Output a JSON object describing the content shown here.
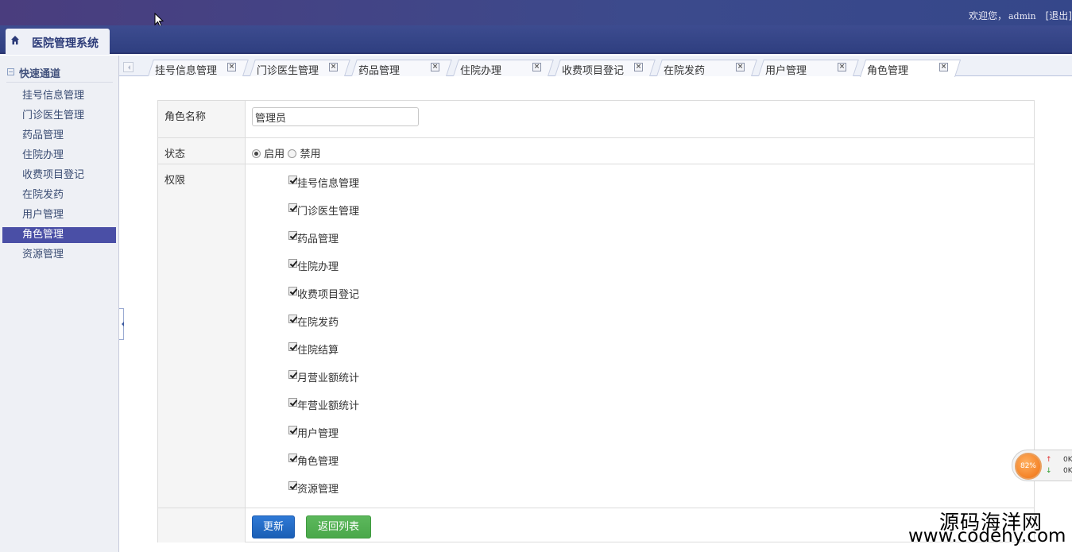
{
  "header": {
    "welcome": "欢迎您，",
    "user": "admin",
    "logout": "[退出]",
    "system_title": "医院管理系统"
  },
  "sidebar": {
    "section_title": "快速通道",
    "items": [
      {
        "label": "挂号信息管理"
      },
      {
        "label": "门诊医生管理"
      },
      {
        "label": "药品管理"
      },
      {
        "label": "住院办理"
      },
      {
        "label": "收费项目登记"
      },
      {
        "label": "在院发药"
      },
      {
        "label": "用户管理"
      },
      {
        "label": "角色管理",
        "active": true
      },
      {
        "label": "资源管理"
      }
    ]
  },
  "tabs": [
    {
      "label": "挂号信息管理"
    },
    {
      "label": "门诊医生管理"
    },
    {
      "label": "药品管理"
    },
    {
      "label": "住院办理"
    },
    {
      "label": "收费项目登记"
    },
    {
      "label": "在院发药"
    },
    {
      "label": "用户管理"
    },
    {
      "label": "角色管理",
      "active": true
    }
  ],
  "tab_close_glyph": "×",
  "form": {
    "name_label": "角色名称",
    "name_value": "管理员",
    "status_label": "状态",
    "status_enabled": "启用",
    "status_disabled": "禁用",
    "status_selected": "启用",
    "perm_label": "权限",
    "permissions": [
      {
        "label": "挂号信息管理",
        "checked": true
      },
      {
        "label": "门诊医生管理",
        "checked": true
      },
      {
        "label": "药品管理",
        "checked": true
      },
      {
        "label": "住院办理",
        "checked": true
      },
      {
        "label": "收费项目登记",
        "checked": true
      },
      {
        "label": "在院发药",
        "checked": true
      },
      {
        "label": "住院结算",
        "checked": true
      },
      {
        "label": "月营业额统计",
        "checked": true
      },
      {
        "label": "年营业额统计",
        "checked": true
      },
      {
        "label": "用户管理",
        "checked": true
      },
      {
        "label": "角色管理",
        "checked": true
      },
      {
        "label": "资源管理",
        "checked": true
      }
    ],
    "update_button": "更新",
    "back_button": "返回列表"
  },
  "widget": {
    "percent": "82%",
    "up_arrow": "↑",
    "down_arrow": "↓",
    "up_value": "0K",
    "down_value": "0K"
  },
  "watermark": {
    "line1": "源码海洋网",
    "line2": "www.codehy.com"
  }
}
